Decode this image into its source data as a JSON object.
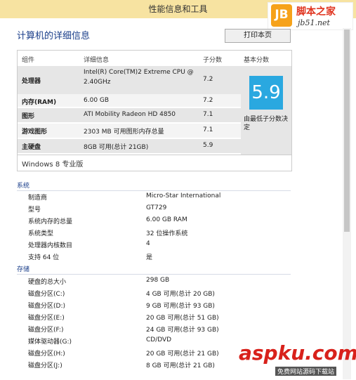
{
  "window_title": "性能信息和工具",
  "logo": {
    "badge": "JB",
    "text": "脚本之家",
    "url": "jb51.net"
  },
  "page_title": "计算机的详细信息",
  "print_button": "打印本页",
  "rating_table": {
    "headers": [
      "组件",
      "详细信息",
      "子分数",
      "基本分数"
    ],
    "rows": [
      {
        "component": "处理器",
        "detail": "Intel(R) Core(TM)2 Extreme CPU @",
        "detail2": "2.40GHz",
        "score": "7.2"
      },
      {
        "component": "内存(RAM)",
        "detail": "6.00 GB",
        "score": "7.2"
      },
      {
        "component": "图形",
        "detail": "ATI Mobility Radeon HD 4850",
        "score": "7.1"
      },
      {
        "component": "游戏图形",
        "detail": "2303 MB 可用图形内存总量",
        "score": "7.1"
      },
      {
        "component": "主硬盘",
        "detail": "8GB 可用(总计 21GB)",
        "score": "5.9"
      }
    ],
    "base_score": "5.9",
    "base_score_note": "由最低子分数决定"
  },
  "os": "Windows 8 专业版",
  "sections": {
    "system": {
      "title": "系统",
      "items": [
        {
          "k": "制造商",
          "v": "Micro-Star International"
        },
        {
          "k": "型号",
          "v": "GT729"
        },
        {
          "k": "系统内存的总量",
          "v": "6.00 GB RAM"
        },
        {
          "k": "系统类型",
          "v": "32 位操作系统"
        },
        {
          "k": "处理器内核数目",
          "v": "4"
        },
        {
          "k": "支持 64 位",
          "v": "是"
        }
      ]
    },
    "storage": {
      "title": "存储",
      "items": [
        {
          "k": "硬盘的总大小",
          "v": "298 GB"
        },
        {
          "k": "磁盘分区(C:)",
          "v": "4 GB 可用(总计 20 GB)"
        },
        {
          "k": "磁盘分区(D:)",
          "v": "9 GB 可用(总计 93 GB)"
        },
        {
          "k": "磁盘分区(E:)",
          "v": "20 GB 可用(总计 51 GB)"
        },
        {
          "k": "磁盘分区(F:)",
          "v": "24 GB 可用(总计 93 GB)"
        },
        {
          "k": "媒体驱动器(G:)",
          "v": "CD/DVD"
        },
        {
          "k": "磁盘分区(H:)",
          "v": "20 GB 可用(总计 21 GB)"
        },
        {
          "k": "磁盘分区(J:)",
          "v": "8 GB 可用(总计 21 GB)"
        }
      ]
    }
  },
  "watermark": {
    "main": "aspku.com",
    "sub": "免费网站源码下载站"
  }
}
